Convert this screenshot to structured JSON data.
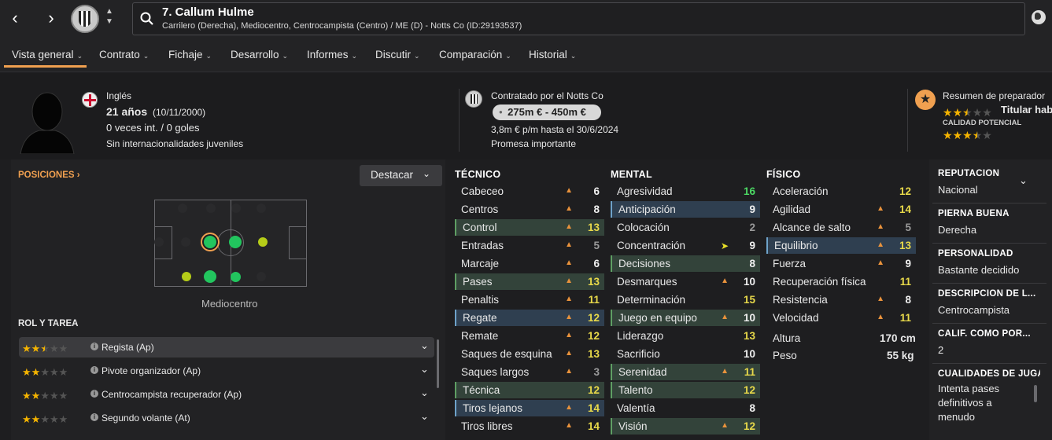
{
  "player": {
    "title": "7. Callum Hulme",
    "subtitle": "Carrilero (Derecha), Mediocentro, Centrocampista (Centro) / ME (D) - Notts Co (ID:29193537)"
  },
  "tabs": [
    "Vista general",
    "Contrato",
    "Fichaje",
    "Desarrollo",
    "Informes",
    "Discutir",
    "Comparación",
    "Historial"
  ],
  "info": {
    "nationality": "Inglés",
    "age": "21 años",
    "dob": "(10/11/2000)",
    "caps": "0 veces int. / 0 goles",
    "youth": "Sin internacionalidades juveniles"
  },
  "contract": {
    "title": "Contratado por el Notts Co",
    "value": "275m € - 450m €",
    "wage": "3,8m € p/m hasta el 30/6/2024",
    "status": "Promesa importante"
  },
  "coach": {
    "title": "Resumen de preparador",
    "role": "Titular hab",
    "potential_label": "CALIDAD POTENCIAL",
    "ability_stars": 2.5,
    "potential_stars": 3.5
  },
  "positions": {
    "header": "POSICIONES",
    "highlight_btn": "Destacar",
    "pitch_label": "Mediocentro"
  },
  "roles": {
    "header": "ROL Y TAREA",
    "items": [
      {
        "name": "Regista (Ap)",
        "stars": 2.5
      },
      {
        "name": "Pivote organizador (Ap)",
        "stars": 2
      },
      {
        "name": "Centrocampista recuperador (Ap)",
        "stars": 2
      },
      {
        "name": "Segundo volante (At)",
        "stars": 2
      }
    ]
  },
  "technical": {
    "header": "TÉCNICO",
    "items": [
      {
        "name": "Cabeceo",
        "value": "6",
        "trend": "up",
        "hl": ""
      },
      {
        "name": "Centros",
        "value": "8",
        "trend": "up",
        "hl": ""
      },
      {
        "name": "Control",
        "value": "13",
        "trend": "up",
        "hl": "g"
      },
      {
        "name": "Entradas",
        "value": "5",
        "trend": "up",
        "hl": ""
      },
      {
        "name": "Marcaje",
        "value": "6",
        "trend": "up",
        "hl": ""
      },
      {
        "name": "Pases",
        "value": "13",
        "trend": "up",
        "hl": "g"
      },
      {
        "name": "Penaltis",
        "value": "11",
        "trend": "up",
        "hl": ""
      },
      {
        "name": "Regate",
        "value": "12",
        "trend": "up",
        "hl": "b"
      },
      {
        "name": "Remate",
        "value": "12",
        "trend": "up",
        "hl": ""
      },
      {
        "name": "Saques de esquina",
        "value": "13",
        "trend": "up",
        "hl": ""
      },
      {
        "name": "Saques largos",
        "value": "3",
        "trend": "up",
        "hl": ""
      },
      {
        "name": "Técnica",
        "value": "12",
        "trend": "",
        "hl": "g"
      },
      {
        "name": "Tiros lejanos",
        "value": "14",
        "trend": "up",
        "hl": "b"
      },
      {
        "name": "Tiros libres",
        "value": "14",
        "trend": "up",
        "hl": ""
      }
    ]
  },
  "mental": {
    "header": "MENTAL",
    "items": [
      {
        "name": "Agresividad",
        "value": "16",
        "trend": "",
        "hl": ""
      },
      {
        "name": "Anticipación",
        "value": "9",
        "trend": "",
        "hl": "b"
      },
      {
        "name": "Colocación",
        "value": "2",
        "trend": "",
        "hl": ""
      },
      {
        "name": "Concentración",
        "value": "9",
        "trend": "big",
        "hl": ""
      },
      {
        "name": "Decisiones",
        "value": "8",
        "trend": "",
        "hl": "g"
      },
      {
        "name": "Desmarques",
        "value": "10",
        "trend": "up",
        "hl": ""
      },
      {
        "name": "Determinación",
        "value": "15",
        "trend": "",
        "hl": ""
      },
      {
        "name": "Juego en equipo",
        "value": "10",
        "trend": "up",
        "hl": "g"
      },
      {
        "name": "Liderazgo",
        "value": "13",
        "trend": "",
        "hl": ""
      },
      {
        "name": "Sacrificio",
        "value": "10",
        "trend": "",
        "hl": ""
      },
      {
        "name": "Serenidad",
        "value": "11",
        "trend": "up",
        "hl": "g"
      },
      {
        "name": "Talento",
        "value": "12",
        "trend": "",
        "hl": "g"
      },
      {
        "name": "Valentía",
        "value": "8",
        "trend": "",
        "hl": ""
      },
      {
        "name": "Visión",
        "value": "12",
        "trend": "up",
        "hl": "g"
      }
    ]
  },
  "physical": {
    "header": "FÍSICO",
    "items": [
      {
        "name": "Aceleración",
        "value": "12",
        "trend": "",
        "hl": ""
      },
      {
        "name": "Agilidad",
        "value": "14",
        "trend": "up",
        "hl": ""
      },
      {
        "name": "Alcance de salto",
        "value": "5",
        "trend": "up",
        "hl": ""
      },
      {
        "name": "Equilibrio",
        "value": "13",
        "trend": "up",
        "hl": "b"
      },
      {
        "name": "Fuerza",
        "value": "9",
        "trend": "up",
        "hl": ""
      },
      {
        "name": "Recuperación física",
        "value": "11",
        "trend": "",
        "hl": ""
      },
      {
        "name": "Resistencia",
        "value": "8",
        "trend": "up",
        "hl": ""
      },
      {
        "name": "Velocidad",
        "value": "11",
        "trend": "up",
        "hl": ""
      }
    ],
    "height_label": "Altura",
    "height": "170 cm",
    "weight_label": "Peso",
    "weight": "55 kg"
  },
  "details": [
    {
      "key": "REPUTACIÓN",
      "value": "Nacional"
    },
    {
      "key": "PIERNA BUENA",
      "value": "Derecha"
    },
    {
      "key": "PERSONALIDAD",
      "value": "Bastante decidido"
    },
    {
      "key": "DESCRIPCIÓN DE L...",
      "value": "Centrocampista"
    },
    {
      "key": "CALIF. COMO POR...",
      "value": "2"
    },
    {
      "key": "CUALIDADES DE JUGA",
      "value": "Intenta pases definitivos a menudo"
    }
  ],
  "colors": {
    "accent": "#f0a050",
    "green_high": "#4cd964",
    "yellow": "#e8d94a",
    "gold": "#f5b400"
  }
}
